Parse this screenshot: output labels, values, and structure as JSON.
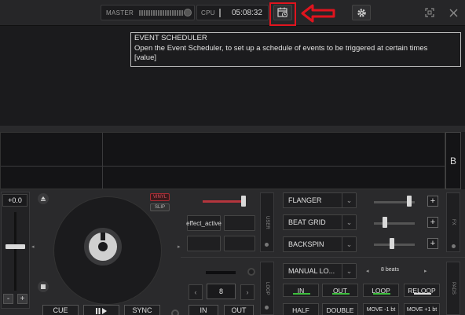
{
  "topbar": {
    "master_label": "MASTER",
    "cpu_label": "CPU",
    "clock": "05:08:32"
  },
  "icons": {
    "scheduler": "event-scheduler-icon",
    "settings": "gear-icon",
    "fullscreen": "fullscreen-icon",
    "close": "close-icon"
  },
  "colors": {
    "highlight": "#e0141e",
    "vinyl": "#e05060",
    "loop_in_indicator": "#3cbf3c",
    "reloop_indicator": "#e0e0e0"
  },
  "tooltip": {
    "title": "EVENT SCHEDULER",
    "line1": "Open the Event Scheduler, to set up a schedule of events to be triggered at certain times",
    "line2": "[value]"
  },
  "waveform": {
    "side_label": "B"
  },
  "deck": {
    "pitch_value": "+0.0",
    "minus": "-",
    "plus": "+",
    "vinyl": "VINYL",
    "slip": "SLIP",
    "effect_active": "effect_active",
    "user_tab": "USER",
    "fx_tab": "FX",
    "loop_tab": "LOOP",
    "pads_tab": "PADS",
    "effects": [
      "FLANGER",
      "BEAT GRID",
      "BACKSPIN"
    ],
    "pad_mode": "MANUAL LO...",
    "beats": "8 beats",
    "loop_length": "8",
    "pads_row1": [
      "IN",
      "OUT",
      "LOOP",
      "RELOOP"
    ],
    "pads_row2": [
      "HALF",
      "DOUBLE",
      "MOVE -1 bt",
      "MOVE +1 bt"
    ],
    "loop_in": "IN",
    "loop_out": "OUT",
    "cue": "CUE",
    "sync": "SYNC",
    "prev": "‹",
    "next": "›"
  }
}
